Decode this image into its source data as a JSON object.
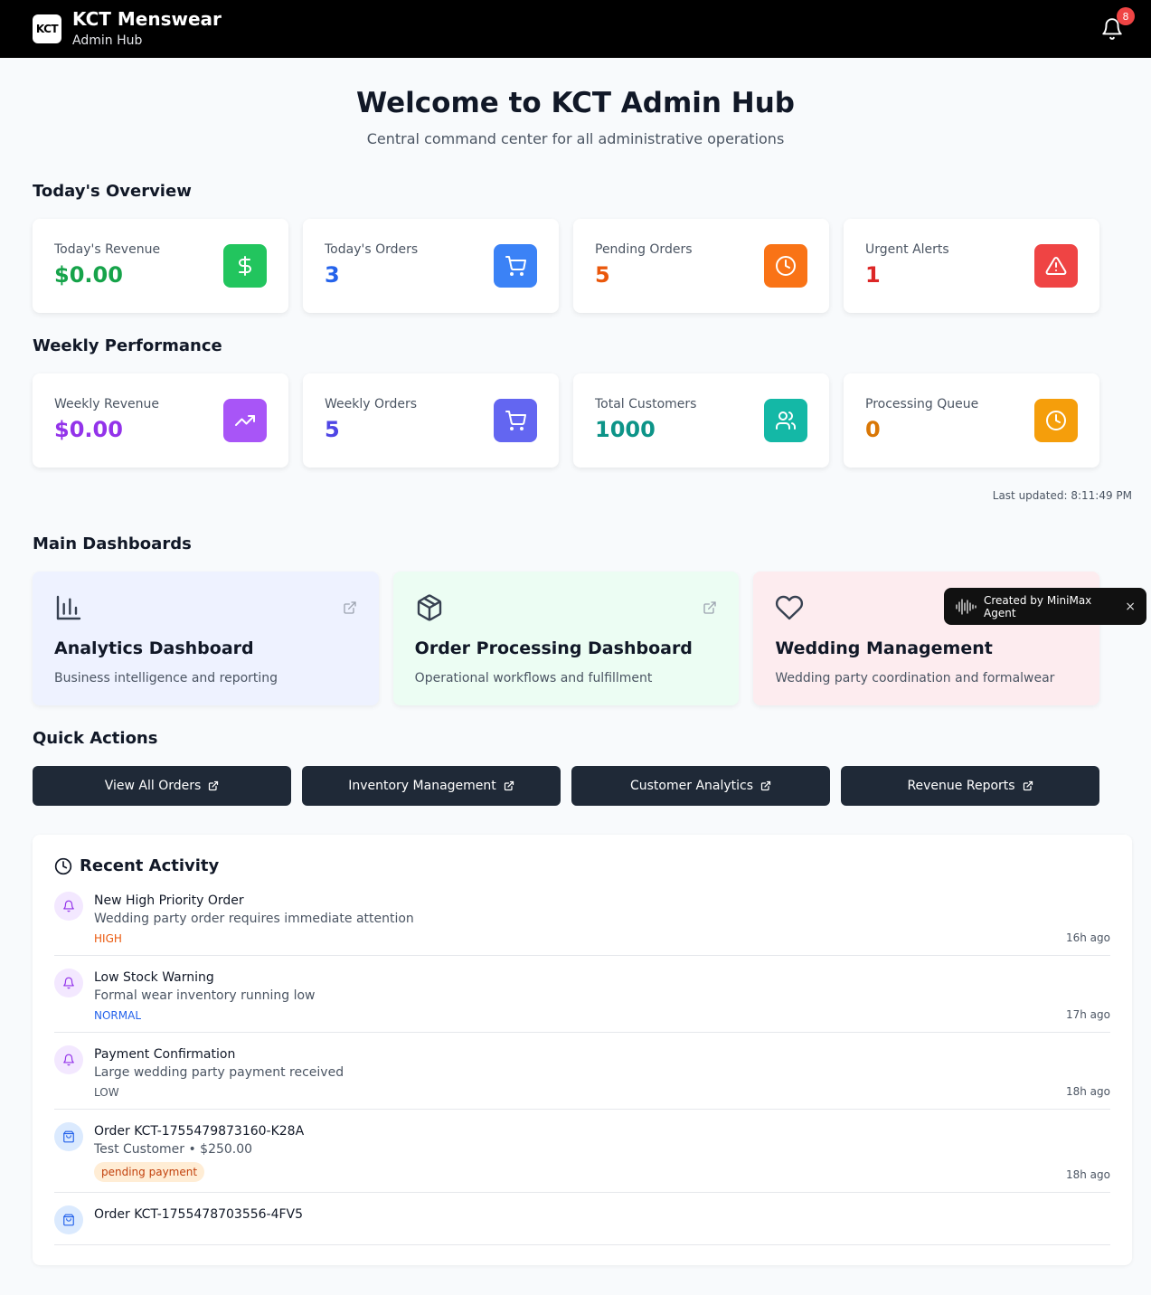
{
  "header": {
    "logo_text": "KCT",
    "title": "KCT Menswear",
    "subtitle": "Admin Hub",
    "notification_count": "8"
  },
  "hero": {
    "title": "Welcome to KCT Admin Hub",
    "subtitle": "Central command center for all administrative operations"
  },
  "today": {
    "title": "Today's Overview",
    "cards": [
      {
        "label": "Today's Revenue",
        "value": "$0.00",
        "color": "#16a34a",
        "icon_bg": "#22c55e",
        "icon": "dollar-icon"
      },
      {
        "label": "Today's Orders",
        "value": "3",
        "color": "#2563eb",
        "icon_bg": "#3b82f6",
        "icon": "cart-icon"
      },
      {
        "label": "Pending Orders",
        "value": "5",
        "color": "#ea580c",
        "icon_bg": "#f97316",
        "icon": "clock-icon"
      },
      {
        "label": "Urgent Alerts",
        "value": "1",
        "color": "#dc2626",
        "icon_bg": "#ef4444",
        "icon": "alert-icon"
      }
    ]
  },
  "weekly": {
    "title": "Weekly Performance",
    "cards": [
      {
        "label": "Weekly Revenue",
        "value": "$0.00",
        "color": "#9333ea",
        "icon_bg": "#a855f7",
        "icon": "trending-up-icon"
      },
      {
        "label": "Weekly Orders",
        "value": "5",
        "color": "#4f46e5",
        "icon_bg": "#6366f1",
        "icon": "cart-icon"
      },
      {
        "label": "Total Customers",
        "value": "1000",
        "color": "#0d9488",
        "icon_bg": "#14b8a6",
        "icon": "users-icon"
      },
      {
        "label": "Processing Queue",
        "value": "0",
        "color": "#d97706",
        "icon_bg": "#f59e0b",
        "icon": "clock-icon"
      }
    ]
  },
  "last_updated": "Last updated: 8:11:49 PM",
  "dashboards": {
    "title": "Main Dashboards",
    "items": [
      {
        "title": "Analytics Dashboard",
        "desc": "Business intelligence and reporting",
        "bg": "#eef2ff",
        "icon": "bar-chart-icon"
      },
      {
        "title": "Order Processing Dashboard",
        "desc": "Operational workflows and fulfillment",
        "bg": "#ecfdf3",
        "icon": "package-icon"
      },
      {
        "title": "Wedding Management",
        "desc": "Wedding party coordination and formalwear",
        "bg": "#fdecef",
        "icon": "heart-icon"
      }
    ]
  },
  "quick_actions": {
    "title": "Quick Actions",
    "buttons": [
      "View All Orders",
      "Inventory Management",
      "Customer Analytics",
      "Revenue Reports"
    ]
  },
  "activity": {
    "title": "Recent Activity",
    "items": [
      {
        "title": "New High Priority Order",
        "desc": "Wedding party order requires immediate attention",
        "tag": "HIGH",
        "tag_color": "#ea580c",
        "time": "16h ago",
        "type": "bell"
      },
      {
        "title": "Low Stock Warning",
        "desc": "Formal wear inventory running low",
        "tag": "NORMAL",
        "tag_color": "#2563eb",
        "time": "17h ago",
        "type": "bell"
      },
      {
        "title": "Payment Confirmation",
        "desc": "Large wedding party payment received",
        "tag": "LOW",
        "tag_color": "#4b5563",
        "time": "18h ago",
        "type": "bell"
      },
      {
        "title": "Order KCT-1755479873160-K28A",
        "desc": "Test Customer • $250.00",
        "pill": "pending payment",
        "time": "18h ago",
        "type": "bag"
      },
      {
        "title": "Order KCT-1755478703556-4FV5",
        "desc": "",
        "time": "",
        "type": "bag"
      }
    ]
  },
  "toast": {
    "label": "Created by MiniMax Agent",
    "close": "×"
  }
}
